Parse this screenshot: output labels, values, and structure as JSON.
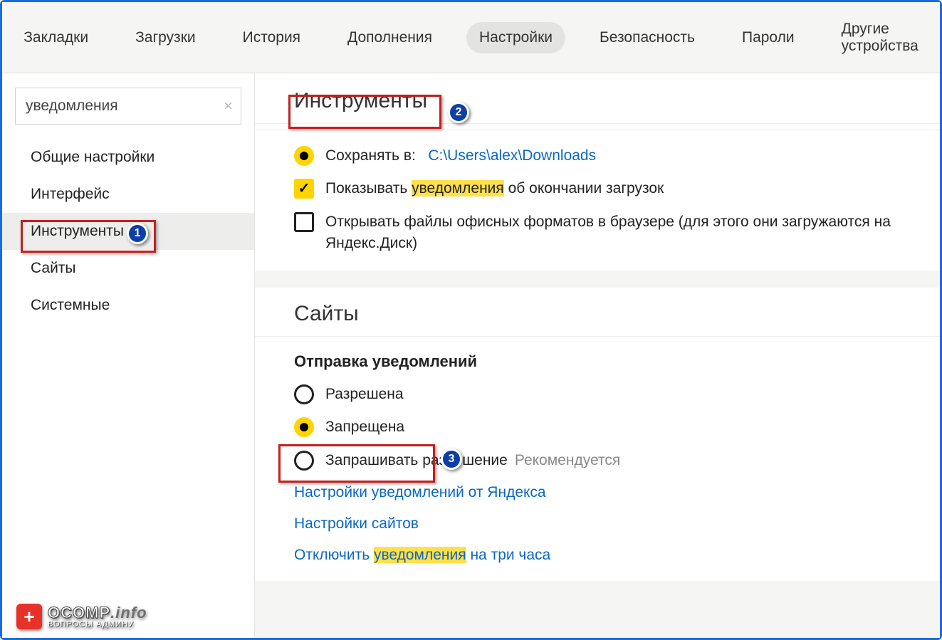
{
  "topbar": {
    "tabs": [
      {
        "label": "Закладки"
      },
      {
        "label": "Загрузки"
      },
      {
        "label": "История"
      },
      {
        "label": "Дополнения"
      },
      {
        "label": "Настройки",
        "active": true
      },
      {
        "label": "Безопасность"
      },
      {
        "label": "Пароли"
      },
      {
        "label": "Другие устройства"
      }
    ]
  },
  "sidebar": {
    "search_value": "уведомления",
    "items": [
      {
        "label": "Общие настройки"
      },
      {
        "label": "Интерфейс"
      },
      {
        "label": "Инструменты",
        "active": true
      },
      {
        "label": "Сайты"
      },
      {
        "label": "Системные"
      }
    ]
  },
  "sections": {
    "tools_title": "Инструменты",
    "save_to_prefix": "Сохранять в:",
    "save_to_path": "C:\\Users\\alex\\Downloads",
    "notify_dl_before": "Показывать ",
    "notify_dl_hl": "уведомления",
    "notify_dl_after": " об окончании загрузок",
    "office_label": "Открывать файлы офисных форматов в браузере (для этого они загружаются на Яндекс.Диск)",
    "sites_title": "Сайты",
    "send_notif_heading": "Отправка уведомлений",
    "radio_allowed": "Разрешена",
    "radio_forbidden": "Запрещена",
    "radio_ask": "Запрашивать разрешение",
    "recommended": "Рекомендуется",
    "link_yandex_notif": "Настройки уведомлений от Яндекса",
    "link_site_settings": "Настройки сайтов",
    "link_disable_before": "Отключить ",
    "link_disable_hl": "уведомления",
    "link_disable_after": " на три часа"
  },
  "watermark": {
    "primary": "OCOMP",
    "suffix": ".info",
    "sub": "ВОПРОСЫ АДМИНУ"
  },
  "badges": {
    "b1": "1",
    "b2": "2",
    "b3": "3"
  }
}
